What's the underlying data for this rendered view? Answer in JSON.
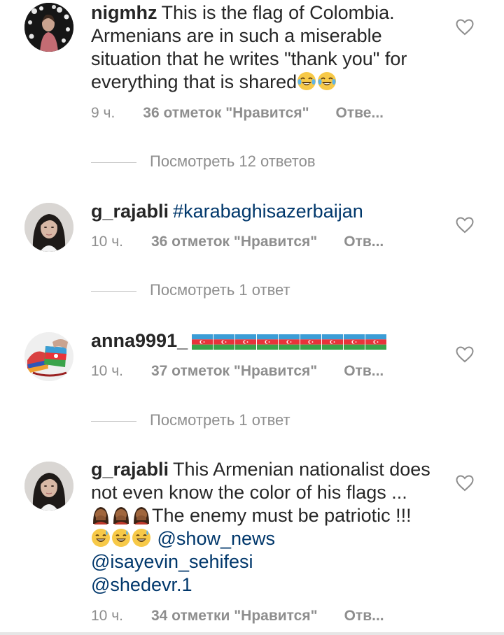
{
  "comments": [
    {
      "username": "nigmhz",
      "text": "This is the flag of Colombia. Armenians are in such a miserable situation that he writes \"thank you\" for everything that is shared",
      "time": "9 ч.",
      "likes": "36 отметок \"Нравится\"",
      "reply": "Отве...",
      "view_replies": "Посмотреть 12 ответов"
    },
    {
      "username": "g_rajabli",
      "text": "#karabaghisazerbaijan",
      "time": "10 ч.",
      "likes": "36 отметок \"Нравится\"",
      "reply": "Отв...",
      "view_replies": "Посмотреть 1 ответ"
    },
    {
      "username": "anna9991_",
      "text": "",
      "time": "10 ч.",
      "likes": "37 отметок \"Нравится\"",
      "reply": "Отв...",
      "view_replies": "Посмотреть 1 ответ"
    },
    {
      "username": "g_rajabli",
      "text_part1": "This Armenian nationalist does not even know the color of his flags ...",
      "text_part2": "The enemy must be patriotic !!!",
      "mention1": "@show_news",
      "mention2": "@isayevin_sehifesi",
      "mention3": "@shedevr.1",
      "time": "10 ч.",
      "likes": "34 отметки \"Нравится\"",
      "reply": "Отв..."
    }
  ],
  "icons": {
    "like": "heart-outline-icon",
    "emoji_laugh": "face-with-tears-of-joy",
    "emoji_sweat": "grinning-face-with-sweat",
    "emoji_facepalm": "person-facepalming",
    "emoji_flag": "flag-azerbaijan"
  },
  "colors": {
    "text": "#262626",
    "meta": "#8e8e8e",
    "mention": "#00376b"
  }
}
